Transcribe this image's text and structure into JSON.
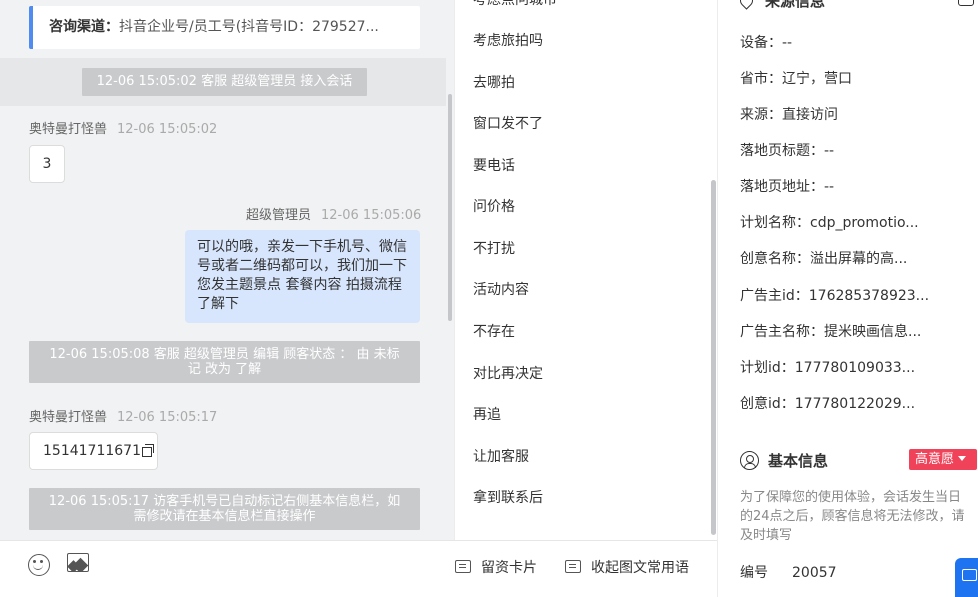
{
  "chat": {
    "channel_label": "咨询渠道：",
    "channel_value": "抖音企业号/员工号(抖音号ID：279527...",
    "system_notices": [
      "12-06 15:05:02 客服 超级管理员 接入会话",
      "12-06 15:05:08 客服 超级管理员 编辑 顾客状态 ： 由 未标记 改为 了解",
      "12-06 15:05:17 访客手机号已自动标记右侧基本信息栏，如需修改请在基本信息栏直接操作"
    ],
    "messages": [
      {
        "sender": "奥特曼打怪兽",
        "time": "12-06 15:05:02",
        "text": "3"
      },
      {
        "sender": "超级管理员",
        "time": "12-06 15:05:06",
        "text": "可以的哦，亲发一下手机号、微信号或者二维码都可以，我们加一下您发主题景点 套餐内容 拍摄流程了解下"
      },
      {
        "sender": "奥特曼打怪兽",
        "time": "12-06 15:05:17",
        "text": "15141711671"
      }
    ]
  },
  "toolbar": {
    "emoji_icon": "emoji-icon",
    "image_icon": "image-icon",
    "lead_card_label": "留资卡片",
    "collapse_label": "收起图文常用语"
  },
  "quick_replies": [
    "考虑点问城市",
    "考虑旅拍吗",
    "去哪拍",
    "窗口发不了",
    "要电话",
    "问价格",
    "不打扰",
    "活动内容",
    "不存在",
    "对比再决定",
    "再追",
    "让加客服",
    "拿到联系后"
  ],
  "source_info": {
    "title": "来源信息",
    "rows": [
      "设备：--",
      "省市：辽宁，营口",
      "来源：直接访问",
      "落地页标题：--",
      "落地页地址：--",
      "计划名称：cdp_promotio...",
      "创意名称：溢出屏幕的高...",
      "广告主id：176285378923...",
      "广告主名称：提米映画信息...",
      "计划id：177780109033...",
      "创意id：177780122029..."
    ]
  },
  "basic_info": {
    "title": "基本信息",
    "intent_badge": "高意愿",
    "notice": "为了保障您的使用体验，会话发生当日的24点之后，顾客信息将无法修改，请及时填写",
    "id_label": "编号",
    "id_value": "20057"
  },
  "colors": {
    "accent": "#4f8bf0",
    "outgoing_bubble": "#d7e6fd",
    "badge_red": "#f0435a",
    "float_button": "#1e73f0"
  }
}
